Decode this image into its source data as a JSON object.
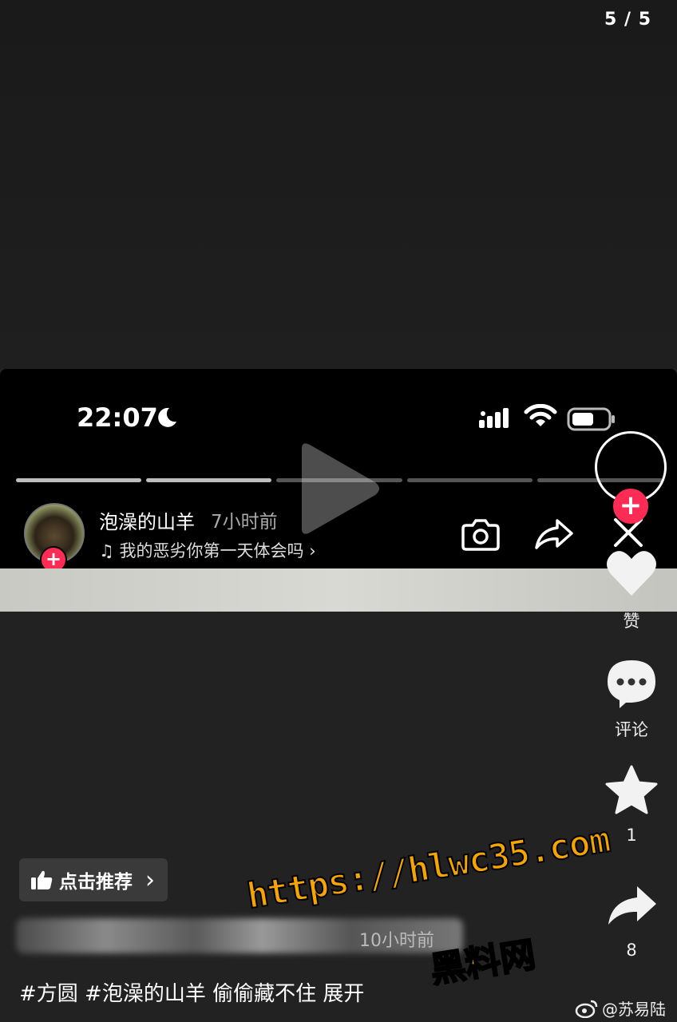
{
  "page_counter": "5 / 5",
  "embedded": {
    "status_time": "22:07",
    "progress": {
      "segments_done": 2,
      "segments_total": 5
    },
    "author": "泡澡的山羊",
    "post_time": "7小时前",
    "music": "我的恶劣你第一天体会吗 ›"
  },
  "rail": {
    "follow_plus": "+",
    "like_label": "赞",
    "comment_label": "评论",
    "favorite_count": "1",
    "share_count": "8"
  },
  "recommend_label": "点击推荐",
  "recommend_chevron": "›",
  "blurred_time": "10小时前",
  "caption": "#方圆 #泡澡的山羊 偷偷藏不住  展开",
  "watermark": {
    "url": "https://hlwc35.com",
    "name": "黑料网"
  },
  "weibo_credit": "@苏易陆",
  "colors": {
    "accent": "#fe2c55",
    "watermark": "#f5a400"
  }
}
